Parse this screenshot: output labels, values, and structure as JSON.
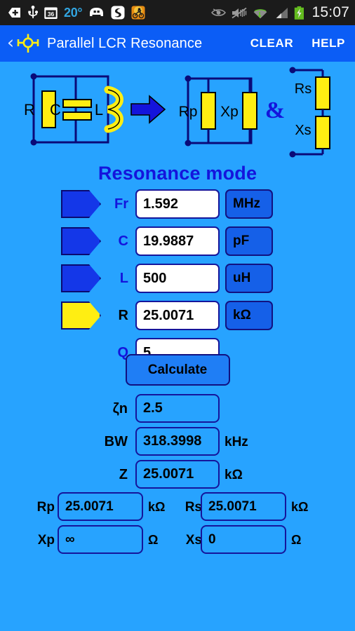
{
  "statusbar": {
    "icons": [
      "vpn-key-icon",
      "usb-icon",
      "calendar-36-icon",
      "weather-temp",
      "car-icon",
      "app-icon",
      "bike-game-icon",
      "eye-icon",
      "mute-icon",
      "wifi-icon",
      "signal-icon",
      "battery-charging-icon"
    ],
    "calendar_day": "36",
    "temperature": "20°",
    "clock": "15:07"
  },
  "actionbar": {
    "back_label": "‹",
    "logo_name": "lcr-logo-icon",
    "title": "Parallel LCR Resonance",
    "clear_label": "CLEAR",
    "help_label": "HELP"
  },
  "diagram": {
    "left_circuit": {
      "r": "R",
      "c": "C",
      "l": "L"
    },
    "arrow": "➜",
    "parallel_circuit": {
      "rp": "Rp",
      "xp": "Xp"
    },
    "ampersand": "&",
    "series_circuit": {
      "rs": "Rs",
      "xs": "Xs"
    }
  },
  "section": {
    "title": "Resonance mode"
  },
  "inputs": [
    {
      "marker": "",
      "is_out": false,
      "label": "Fr",
      "value": "1.592",
      "unit": "MHz"
    },
    {
      "marker": "",
      "is_out": false,
      "label": "C",
      "value": "19.9887",
      "unit": "pF"
    },
    {
      "marker": "",
      "is_out": false,
      "label": "L",
      "value": "500",
      "unit": "uH"
    },
    {
      "marker": "OUT",
      "is_out": true,
      "label": "R",
      "value": "25.0071",
      "unit": "kΩ"
    },
    {
      "marker": null,
      "is_out": false,
      "label": "Q",
      "value": "5",
      "unit": null
    }
  ],
  "calculate": {
    "label": "Calculate"
  },
  "outputs": [
    {
      "label": "ζn",
      "value": "2.5",
      "unit": ""
    },
    {
      "label": "BW",
      "value": "318.3998",
      "unit": "kHz"
    },
    {
      "label": "Z",
      "value": "25.0071",
      "unit": "kΩ"
    }
  ],
  "pairs": [
    {
      "left": {
        "label": "Rp",
        "value": "25.0071",
        "unit": "kΩ"
      },
      "right": {
        "label": "Rs",
        "value": "25.0071",
        "unit": "kΩ"
      }
    },
    {
      "left": {
        "label": "Xp",
        "value": "∞",
        "unit": "Ω"
      },
      "right": {
        "label": "Xs",
        "value": "0",
        "unit": "Ω"
      }
    }
  ],
  "colors": {
    "background": "#27a3ff",
    "actionbar": "#0b5df6",
    "statusbar": "#1b1b1b",
    "accent_navy": "#15159b",
    "title_blue": "#1414dc",
    "component_yellow": "#ffee12",
    "unit_button": "#1560e8"
  }
}
